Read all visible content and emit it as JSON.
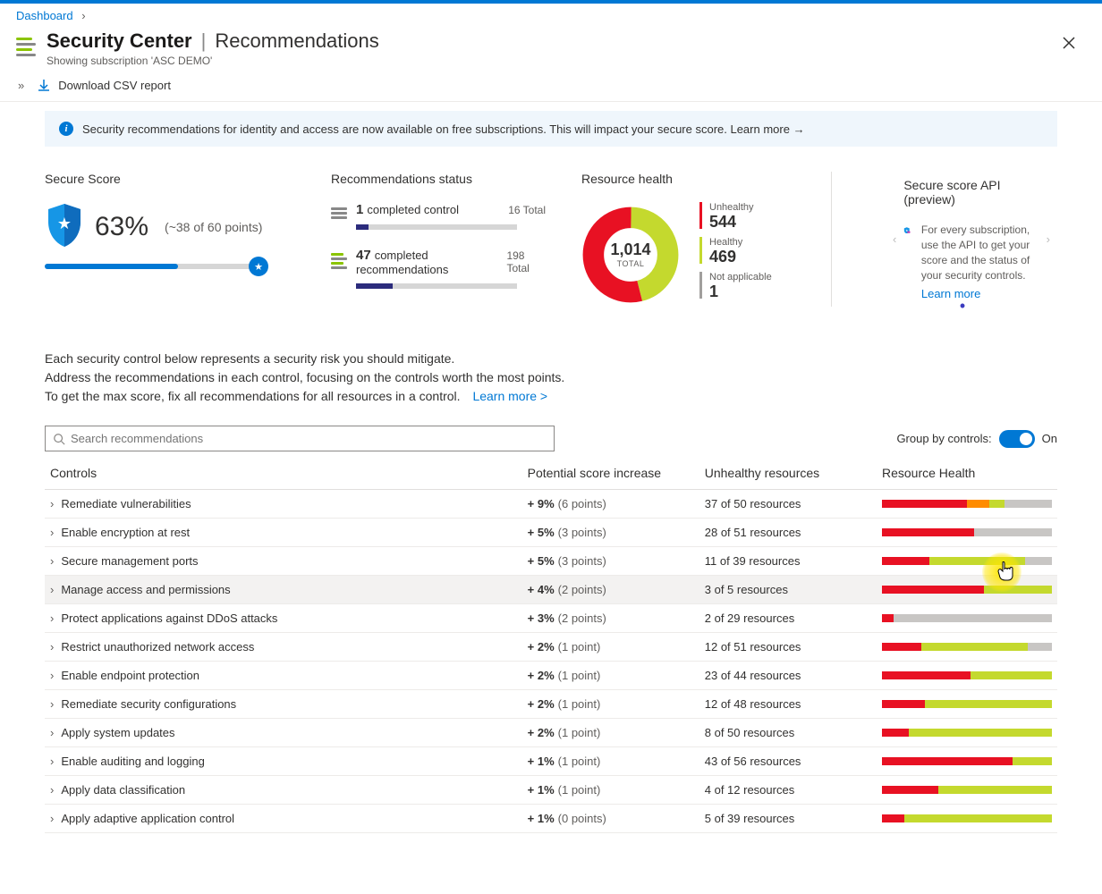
{
  "breadcrumb": {
    "dashboard": "Dashboard"
  },
  "header": {
    "brand": "Security Center",
    "sep": "|",
    "section": "Recommendations",
    "subscription": "Showing subscription 'ASC DEMO'"
  },
  "cmdbar": {
    "download": "Download CSV report"
  },
  "banner": {
    "text": "Security recommendations for identity and access are now available on free subscriptions. This will impact your secure score. Learn more →"
  },
  "score": {
    "title": "Secure Score",
    "percent": "63%",
    "points": "(~38 of 60 points)",
    "fill_pct": 62
  },
  "recstatus": {
    "title": "Recommendations status",
    "ctrl_num": "1",
    "ctrl_lbl": "completed control",
    "ctrl_total": "16 Total",
    "ctrl_fill": 8,
    "rec_num": "47",
    "rec_lbl": "completed recommendations",
    "rec_total": "198 Total",
    "rec_fill": 23
  },
  "rhealth": {
    "title": "Resource health",
    "total": "1,014",
    "total_lbl": "TOTAL",
    "unhealthy_lbl": "Unhealthy",
    "unhealthy": "544",
    "healthy_lbl": "Healthy",
    "healthy": "469",
    "na_lbl": "Not applicable",
    "na": "1"
  },
  "api": {
    "title": "Secure score API (preview)",
    "text": "For every subscription, use the API to get your score and the status of your security controls.",
    "learn": "Learn more"
  },
  "desc": {
    "l1": "Each security control below represents a security risk you should mitigate.",
    "l2": "Address the recommendations in each control, focusing on the controls worth the most points.",
    "l3": "To get the max score, fix all recommendations for all resources in a control.",
    "learn": "Learn more >"
  },
  "search": {
    "placeholder": "Search recommendations"
  },
  "group": {
    "label": "Group by controls:",
    "state": "On"
  },
  "cols": {
    "c1": "Controls",
    "c2": "Potential score increase",
    "c3": "Unhealthy resources",
    "c4": "Resource Health"
  },
  "rows": [
    {
      "name": "Remediate vulnerabilities",
      "psi": "+ 9%",
      "pts": "(6 points)",
      "res": "37 of 50 resources",
      "bar": [
        [
          "#e81123",
          50
        ],
        [
          "#ff8c00",
          13
        ],
        [
          "#c4d92e",
          9
        ],
        [
          "#c8c6c4",
          28
        ]
      ]
    },
    {
      "name": "Enable encryption at rest",
      "psi": "+ 5%",
      "pts": "(3 points)",
      "res": "28 of 51 resources",
      "bar": [
        [
          "#e81123",
          54
        ],
        [
          "#c8c6c4",
          46
        ]
      ]
    },
    {
      "name": "Secure management ports",
      "psi": "+ 5%",
      "pts": "(3 points)",
      "res": "11 of 39 resources",
      "bar": [
        [
          "#e81123",
          28
        ],
        [
          "#c4d92e",
          56
        ],
        [
          "#c8c6c4",
          16
        ]
      ]
    },
    {
      "name": "Manage access and permissions",
      "psi": "+ 4%",
      "pts": "(2 points)",
      "res": "3 of 5 resources",
      "bar": [
        [
          "#e81123",
          60
        ],
        [
          "#c4d92e",
          40
        ]
      ],
      "hover": true
    },
    {
      "name": "Protect applications against DDoS attacks",
      "psi": "+ 3%",
      "pts": "(2 points)",
      "res": "2 of 29 resources",
      "bar": [
        [
          "#e81123",
          7
        ],
        [
          "#c8c6c4",
          93
        ]
      ]
    },
    {
      "name": "Restrict unauthorized network access",
      "psi": "+ 2%",
      "pts": "(1 point)",
      "res": "12 of 51 resources",
      "bar": [
        [
          "#e81123",
          23
        ],
        [
          "#c4d92e",
          63
        ],
        [
          "#c8c6c4",
          14
        ]
      ]
    },
    {
      "name": "Enable endpoint protection",
      "psi": "+ 2%",
      "pts": "(1 point)",
      "res": "23 of 44 resources",
      "bar": [
        [
          "#e81123",
          52
        ],
        [
          "#c4d92e",
          48
        ]
      ]
    },
    {
      "name": "Remediate security configurations",
      "psi": "+ 2%",
      "pts": "(1 point)",
      "res": "12 of 48 resources",
      "bar": [
        [
          "#e81123",
          25
        ],
        [
          "#c4d92e",
          75
        ]
      ]
    },
    {
      "name": "Apply system updates",
      "psi": "+ 2%",
      "pts": "(1 point)",
      "res": "8 of 50 resources",
      "bar": [
        [
          "#e81123",
          16
        ],
        [
          "#c4d92e",
          84
        ]
      ]
    },
    {
      "name": "Enable auditing and logging",
      "psi": "+ 1%",
      "pts": "(1 point)",
      "res": "43 of 56 resources",
      "bar": [
        [
          "#e81123",
          77
        ],
        [
          "#c4d92e",
          23
        ]
      ]
    },
    {
      "name": "Apply data classification",
      "psi": "+ 1%",
      "pts": "(1 point)",
      "res": "4 of 12 resources",
      "bar": [
        [
          "#e81123",
          33
        ],
        [
          "#c4d92e",
          67
        ]
      ]
    },
    {
      "name": "Apply adaptive application control",
      "psi": "+ 1%",
      "pts": "(0 points)",
      "res": "5 of 39 resources",
      "bar": [
        [
          "#e81123",
          13
        ],
        [
          "#c4d92e",
          87
        ]
      ]
    }
  ],
  "chart_data": {
    "type": "pie",
    "title": "Resource health",
    "series": [
      {
        "name": "Unhealthy",
        "value": 544,
        "color": "#e81123"
      },
      {
        "name": "Healthy",
        "value": 469,
        "color": "#c4d92e"
      },
      {
        "name": "Not applicable",
        "value": 1,
        "color": "#a19f9d"
      }
    ],
    "total": 1014
  }
}
